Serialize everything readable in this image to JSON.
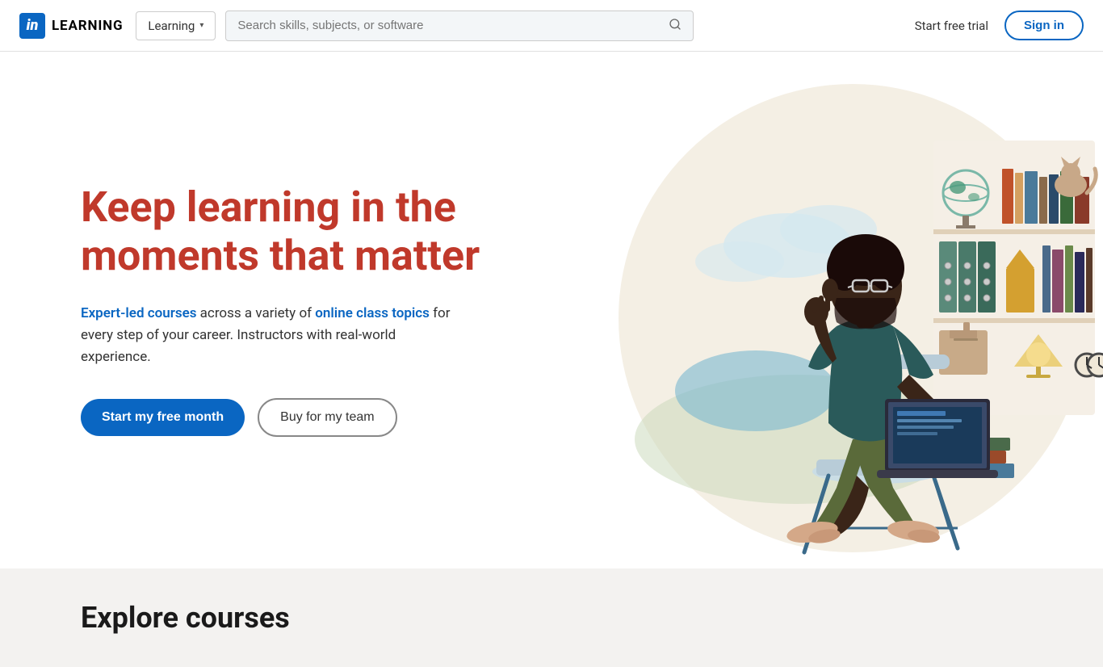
{
  "navbar": {
    "logo_letter": "in",
    "brand_name": "LEARNING",
    "dropdown_label": "Learning",
    "search_placeholder": "Search skills, subjects, or software",
    "start_free_trial": "Start free trial",
    "sign_in": "Sign in"
  },
  "hero": {
    "title_line1": "Keep learning in the",
    "title_line2": "moments that matter",
    "subtitle_part1": "",
    "expert_led": "Expert-led courses",
    "subtitle_mid": " across a variety of ",
    "online_class": "online class topics",
    "subtitle_end": " for every step of your career. Instructors with real-world experience.",
    "cta_primary": "Start my free month",
    "cta_secondary": "Buy for my team"
  },
  "explore": {
    "title": "Explore courses"
  },
  "colors": {
    "linkedin_blue": "#0a66c2",
    "hero_title_red": "#c0392b",
    "bg_circle": "#f0e8d8"
  }
}
